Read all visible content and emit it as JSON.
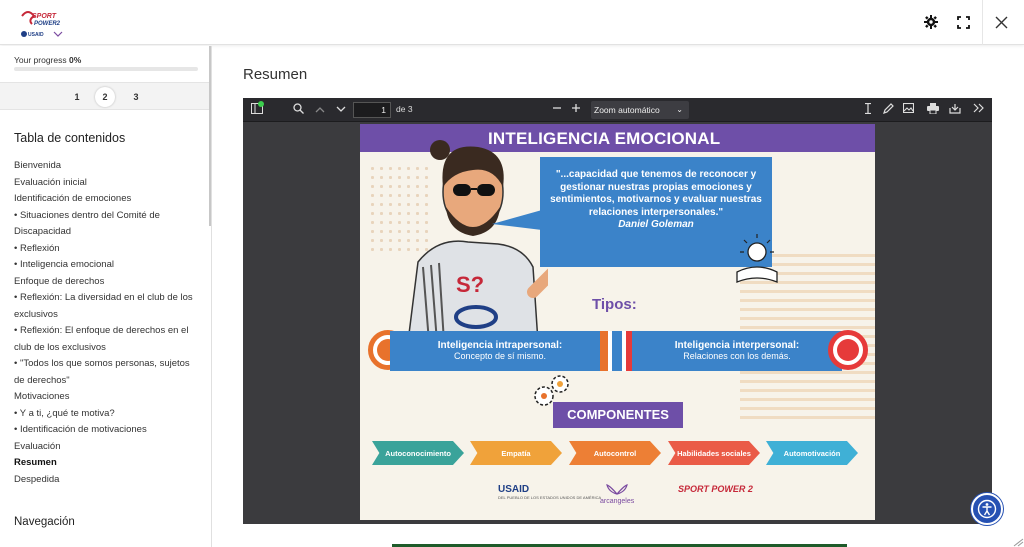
{
  "topbar": {
    "logo_text": "SPORT POWER 2",
    "icons": [
      "gear-icon",
      "fullscreen-icon",
      "close-icon"
    ]
  },
  "sidebar": {
    "progress_label": "Your progress",
    "progress_value": "0%",
    "progress_fraction": 0,
    "pages": [
      "1",
      "2",
      "3"
    ],
    "active_page": "2",
    "toc_title": "Tabla de contenidos",
    "toc": [
      {
        "label": "Bienvenida"
      },
      {
        "label": "Evaluación inicial"
      },
      {
        "label": "Identificación de emociones"
      },
      {
        "label": "• Situaciones dentro del Comité de"
      },
      {
        "label": "Discapacidad"
      },
      {
        "label": "• Reflexión"
      },
      {
        "label": "• Inteligencia emocional"
      },
      {
        "label": "Enfoque de derechos"
      },
      {
        "label": "• Reflexión: La diversidad en el club de los"
      },
      {
        "label": "exclusivos"
      },
      {
        "label": "• Reflexión: El enfoque de derechos en el"
      },
      {
        "label": "club de los exclusivos"
      },
      {
        "label": "• \"Todos los que somos personas, sujetos"
      },
      {
        "label": "de derechos\""
      },
      {
        "label": "Motivaciones"
      },
      {
        "label": "• Y a ti, ¿qué te motiva?"
      },
      {
        "label": "• Identificación de motivaciones"
      },
      {
        "label": "Evaluación"
      },
      {
        "label": "Resumen",
        "active": true
      },
      {
        "label": "Despedida"
      }
    ],
    "nav_title": "Navegación"
  },
  "main": {
    "heading": "Resumen"
  },
  "pdf_viewer": {
    "page_input": "1",
    "page_of": "de 3",
    "zoom": "Zoom automático"
  },
  "infographic": {
    "title": "INTELIGENCIA EMOCIONAL",
    "quote": "\"...capacidad que tenemos de reconocer y gestionar nuestras propias emociones y sentimientos, motivarnos y evaluar nuestras relaciones interpersonales.\"",
    "author": "Daniel Goleman",
    "tipos_label": "Tipos:",
    "types": [
      {
        "name": "Inteligencia intrapersonal:",
        "desc": "Concepto de sí mismo."
      },
      {
        "name": "Inteligencia interpersonal:",
        "desc": "Relaciones con los demás."
      }
    ],
    "componentes_label": "COMPONENTES",
    "components": [
      "Autoconocimiento",
      "Empatía",
      "Autocontrol",
      "Habilidades sociales",
      "Automotivación"
    ],
    "logos": {
      "usaid": "USAID",
      "usaid_sub": "DEL PUEBLO DE LOS ESTADOS UNIDOS DE AMÉRICA",
      "arcangeles": "arcangeles",
      "sport_power": "SPORT POWER 2"
    },
    "colors": {
      "purple": "#6e4fa8",
      "blue": "#3b83c9",
      "orange": "#e8722c",
      "red": "#e63a3a"
    }
  }
}
